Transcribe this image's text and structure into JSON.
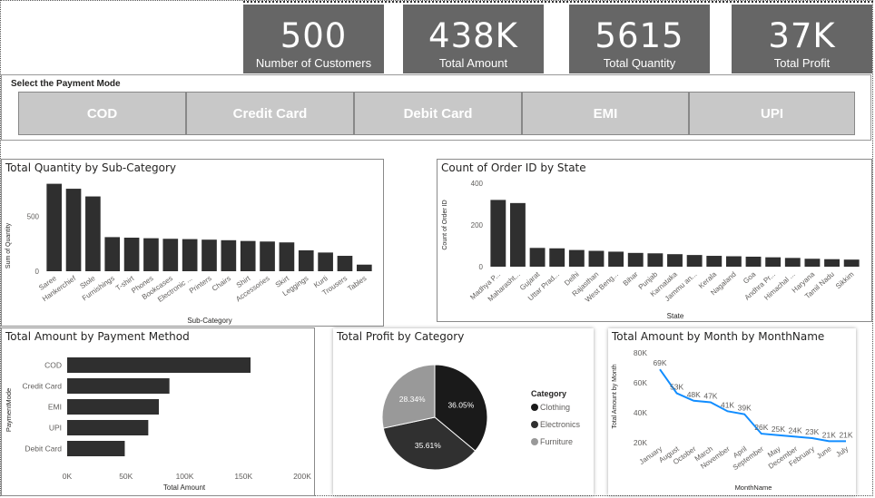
{
  "kpis": [
    {
      "value": "500",
      "label": "Number of Customers"
    },
    {
      "value": "438K",
      "label": "Total Amount"
    },
    {
      "value": "5615",
      "label": "Total Quantity"
    },
    {
      "value": "37K",
      "label": "Total Profit"
    }
  ],
  "slicer": {
    "title": "Select the Payment Mode",
    "options": [
      "COD",
      "Credit Card",
      "Debit Card",
      "EMI",
      "UPI"
    ]
  },
  "charts": {
    "subcategory": {
      "title": "Total Quantity by Sub-Category"
    },
    "state": {
      "title": "Count of Order ID by State"
    },
    "payment": {
      "title": "Total Amount by Payment Method"
    },
    "category": {
      "title": "Total Profit by Category",
      "legend_title": "Category"
    },
    "month": {
      "title": "Total Amount by Month by MonthName"
    }
  },
  "chart_data": [
    {
      "id": "subcategory",
      "type": "bar",
      "title": "Total Quantity by Sub-Category",
      "xlabel": "Sub-Category",
      "ylabel": "Sum of Quantity",
      "ylim": [
        0,
        800
      ],
      "yticks": [
        0,
        500
      ],
      "bar_color": "#2f2f2f",
      "categories": [
        "Saree",
        "Hankerchief",
        "Stole",
        "Furnishings",
        "T-shirt",
        "Phones",
        "Bookcases",
        "Electronic ...",
        "Printers",
        "Chairs",
        "Shirt",
        "Accessories",
        "Skirt",
        "Leggings",
        "Kurti",
        "Trousers",
        "Tables"
      ],
      "values": [
        795,
        750,
        680,
        310,
        305,
        300,
        295,
        292,
        287,
        282,
        275,
        270,
        262,
        190,
        170,
        140,
        60
      ]
    },
    {
      "id": "state",
      "type": "bar",
      "title": "Count of Order ID by State",
      "xlabel": "State",
      "ylabel": "Count of Order ID",
      "ylim": [
        0,
        400
      ],
      "yticks": [
        0,
        200,
        400
      ],
      "bar_color": "#2f2f2f",
      "categories": [
        "Madhya P...",
        "Maharasht...",
        "Gujarat",
        "Uttar Prad...",
        "Delhi",
        "Rajasthan",
        "West Beng...",
        "Bihar",
        "Punjab",
        "Karnataka",
        "Jammu an...",
        "Kerala",
        "Nagaland",
        "Goa",
        "Andhra Pr...",
        "Himachal ...",
        "Haryana",
        "Tamil Nadu",
        "Sikkim"
      ],
      "values": [
        320,
        305,
        90,
        88,
        80,
        76,
        72,
        66,
        64,
        60,
        56,
        52,
        50,
        48,
        45,
        42,
        38,
        36,
        34
      ]
    },
    {
      "id": "payment",
      "type": "bar",
      "orientation": "horizontal",
      "title": "Total Amount by Payment Method",
      "xlabel": "Total Amount",
      "ylabel": "PaymentMode",
      "xlim": [
        0,
        200000
      ],
      "xticks": [
        "0K",
        "50K",
        "100K",
        "150K",
        "200K"
      ],
      "bar_color": "#2f2f2f",
      "categories": [
        "COD",
        "Credit Card",
        "EMI",
        "UPI",
        "Debit Card"
      ],
      "values": [
        156000,
        87000,
        78000,
        69000,
        49000
      ]
    },
    {
      "id": "category",
      "type": "pie",
      "title": "Total Profit by Category",
      "legend_title": "Category",
      "categories": [
        "Clothing",
        "Electronics",
        "Furniture"
      ],
      "values": [
        36.05,
        35.61,
        28.34
      ],
      "labels": [
        "36.05%",
        "35.61%",
        "28.34%"
      ],
      "colors": [
        "#1a1a1a",
        "#303030",
        "#999999"
      ]
    },
    {
      "id": "month",
      "type": "line",
      "title": "Total Amount by Month by MonthName",
      "xlabel": "MonthName",
      "ylabel": "Total Amount by Month",
      "ylim": [
        20000,
        80000
      ],
      "yticks": [
        "20K",
        "40K",
        "60K",
        "80K"
      ],
      "color": "#118dff",
      "x": [
        "January",
        "August",
        "October",
        "March",
        "November",
        "April",
        "September",
        "May",
        "December",
        "February",
        "June",
        "July"
      ],
      "values": [
        69000,
        53000,
        48000,
        47000,
        41000,
        39000,
        26000,
        25000,
        24000,
        23000,
        21000,
        21000
      ],
      "labels": [
        "69K",
        "53K",
        "48K",
        "47K",
        "41K",
        "39K",
        "26K",
        "25K",
        "24K",
        "23K",
        "21K",
        "21K"
      ]
    }
  ]
}
